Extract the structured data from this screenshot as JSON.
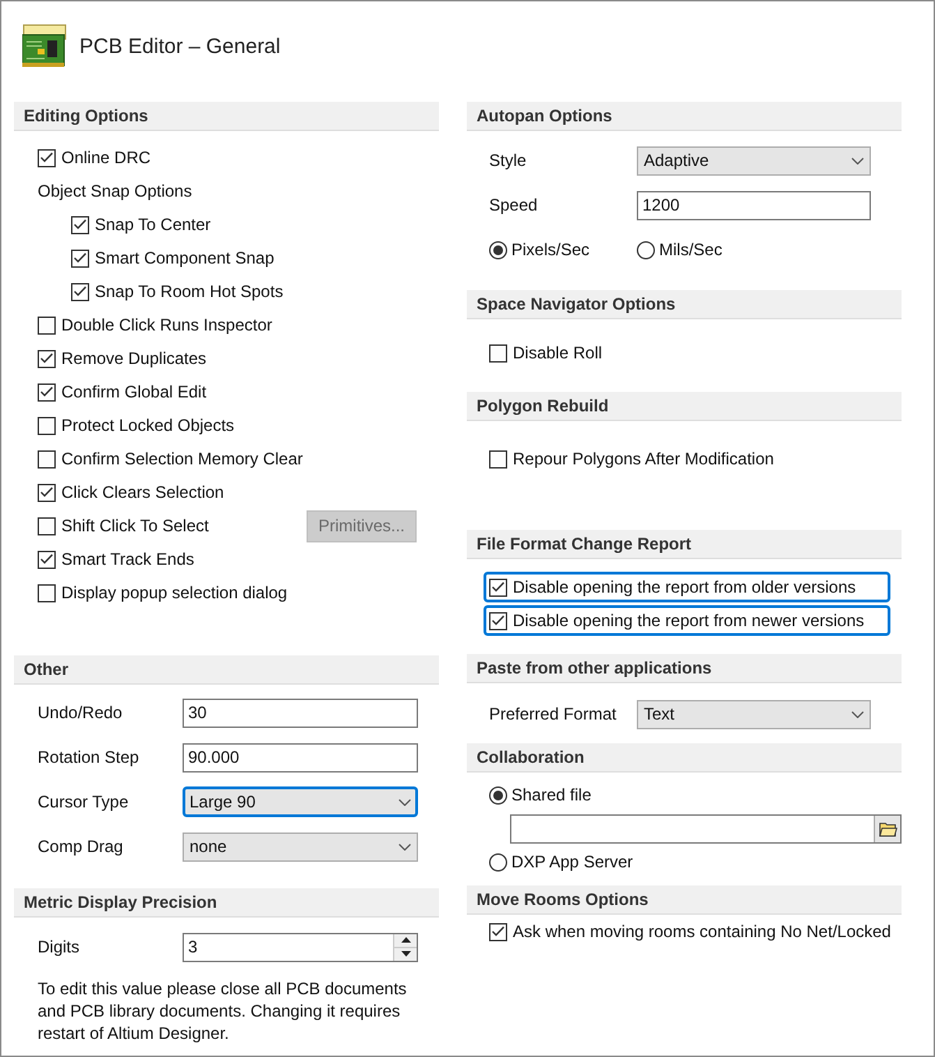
{
  "title": "PCB Editor – General",
  "columns": [
    {
      "sections": [
        {
          "header": "Editing Options",
          "rows": [
            {
              "kind": "checkbox",
              "label": "Online DRC",
              "checked": true,
              "focused": false
            },
            {
              "kind": "group",
              "label": "Object Snap Options",
              "children": [
                {
                  "kind": "checkbox",
                  "label": "Snap To Center",
                  "checked": true,
                  "focused": false
                },
                {
                  "kind": "checkbox",
                  "label": "Smart Component Snap",
                  "checked": true,
                  "focused": false
                },
                {
                  "kind": "checkbox",
                  "label": "Snap To Room Hot Spots",
                  "checked": true,
                  "focused": false
                }
              ]
            },
            {
              "kind": "checkbox",
              "label": "Double Click Runs Inspector",
              "checked": false,
              "focused": false
            },
            {
              "kind": "checkbox",
              "label": "Remove Duplicates",
              "checked": true,
              "focused": false
            },
            {
              "kind": "checkbox",
              "label": "Confirm Global Edit",
              "checked": true,
              "focused": false
            },
            {
              "kind": "checkbox",
              "label": "Protect Locked Objects",
              "checked": false,
              "focused": false
            },
            {
              "kind": "checkbox",
              "label": "Confirm Selection Memory Clear",
              "checked": false,
              "focused": false
            },
            {
              "kind": "checkbox",
              "label": "Click Clears Selection",
              "checked": true,
              "focused": false
            },
            {
              "kind": "checkbox",
              "label": "Shift Click To Select",
              "checked": false,
              "focused": false,
              "button": {
                "label": "Primitives...",
                "disabled": true
              }
            },
            {
              "kind": "checkbox",
              "label": "Smart Track Ends",
              "checked": true,
              "focused": false
            },
            {
              "kind": "checkbox",
              "label": "Display popup selection dialog",
              "checked": false,
              "focused": false
            }
          ]
        },
        {
          "header": "Other",
          "rows": [
            {
              "kind": "field",
              "label": "Undo/Redo",
              "value": "30"
            },
            {
              "kind": "field",
              "label": "Rotation Step",
              "value": "90.000"
            },
            {
              "kind": "select",
              "label": "Cursor Type",
              "value": "Large 90",
              "focused": true
            },
            {
              "kind": "select",
              "label": "Comp Drag",
              "value": "none",
              "focused": false
            }
          ]
        },
        {
          "header": "Metric Display Precision",
          "rows": [
            {
              "kind": "spinner",
              "label": "Digits",
              "value": "3"
            },
            {
              "kind": "note",
              "text": "To edit this value please close all PCB documents and PCB library documents. Changing it requires restart of Altium Designer."
            }
          ]
        }
      ]
    },
    {
      "sections": [
        {
          "header": "Autopan Options",
          "rows": [
            {
              "kind": "select",
              "label": "Style",
              "value": "Adaptive",
              "focused": false
            },
            {
              "kind": "field",
              "label": "Speed",
              "value": "1200"
            },
            {
              "kind": "radio_pair",
              "options": [
                {
                  "label": "Pixels/Sec",
                  "selected": true
                },
                {
                  "label": "Mils/Sec",
                  "selected": false
                }
              ]
            }
          ]
        },
        {
          "header": "Space Navigator Options",
          "rows": [
            {
              "kind": "checkbox",
              "label": "Disable Roll",
              "checked": false,
              "focused": false
            }
          ]
        },
        {
          "header": "Polygon Rebuild",
          "rows": [
            {
              "kind": "checkbox",
              "label": "Repour Polygons After Modification",
              "checked": false,
              "focused": false
            }
          ]
        },
        {
          "header": "File Format Change Report",
          "rows": [
            {
              "kind": "checkbox",
              "label": "Disable opening the report from older versions",
              "checked": true,
              "focused": true
            },
            {
              "kind": "checkbox",
              "label": "Disable opening the report from newer versions",
              "checked": true,
              "focused": true
            }
          ]
        },
        {
          "header": "Paste from other applications",
          "rows": [
            {
              "kind": "select",
              "label": "Preferred Format",
              "value": "Text",
              "focused": false
            }
          ]
        },
        {
          "header": "Collaboration",
          "rows": [
            {
              "kind": "radio",
              "label": "Shared file",
              "selected": true
            },
            {
              "kind": "file_field"
            },
            {
              "kind": "radio",
              "label": "DXP App Server",
              "selected": false
            }
          ]
        },
        {
          "header": "Move Rooms Options",
          "rows": [
            {
              "kind": "checkbox",
              "label": "Ask when moving rooms containing No Net/Locked",
              "checked": true,
              "focused": false
            }
          ]
        }
      ]
    }
  ]
}
